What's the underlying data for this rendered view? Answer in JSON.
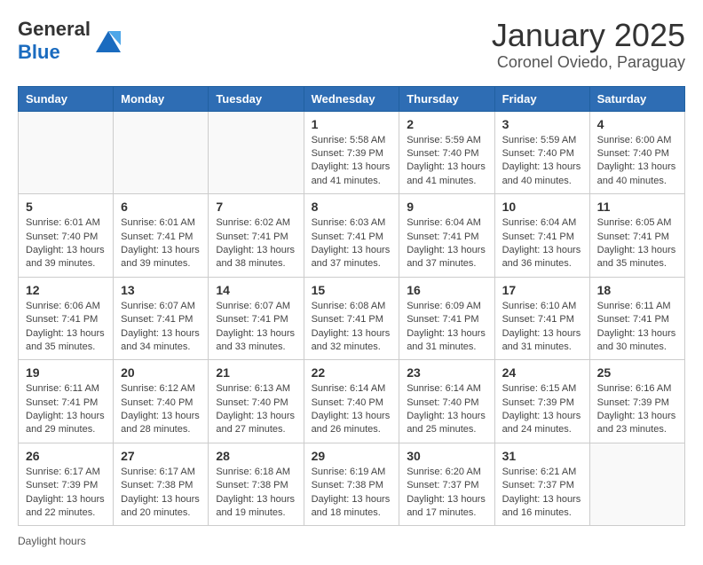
{
  "header": {
    "logo_general": "General",
    "logo_blue": "Blue",
    "month": "January 2025",
    "location": "Coronel Oviedo, Paraguay"
  },
  "days_of_week": [
    "Sunday",
    "Monday",
    "Tuesday",
    "Wednesday",
    "Thursday",
    "Friday",
    "Saturday"
  ],
  "weeks": [
    [
      {
        "day": "",
        "info": ""
      },
      {
        "day": "",
        "info": ""
      },
      {
        "day": "",
        "info": ""
      },
      {
        "day": "1",
        "info": "Sunrise: 5:58 AM\nSunset: 7:39 PM\nDaylight: 13 hours and 41 minutes."
      },
      {
        "day": "2",
        "info": "Sunrise: 5:59 AM\nSunset: 7:40 PM\nDaylight: 13 hours and 41 minutes."
      },
      {
        "day": "3",
        "info": "Sunrise: 5:59 AM\nSunset: 7:40 PM\nDaylight: 13 hours and 40 minutes."
      },
      {
        "day": "4",
        "info": "Sunrise: 6:00 AM\nSunset: 7:40 PM\nDaylight: 13 hours and 40 minutes."
      }
    ],
    [
      {
        "day": "5",
        "info": "Sunrise: 6:01 AM\nSunset: 7:40 PM\nDaylight: 13 hours and 39 minutes."
      },
      {
        "day": "6",
        "info": "Sunrise: 6:01 AM\nSunset: 7:41 PM\nDaylight: 13 hours and 39 minutes."
      },
      {
        "day": "7",
        "info": "Sunrise: 6:02 AM\nSunset: 7:41 PM\nDaylight: 13 hours and 38 minutes."
      },
      {
        "day": "8",
        "info": "Sunrise: 6:03 AM\nSunset: 7:41 PM\nDaylight: 13 hours and 37 minutes."
      },
      {
        "day": "9",
        "info": "Sunrise: 6:04 AM\nSunset: 7:41 PM\nDaylight: 13 hours and 37 minutes."
      },
      {
        "day": "10",
        "info": "Sunrise: 6:04 AM\nSunset: 7:41 PM\nDaylight: 13 hours and 36 minutes."
      },
      {
        "day": "11",
        "info": "Sunrise: 6:05 AM\nSunset: 7:41 PM\nDaylight: 13 hours and 35 minutes."
      }
    ],
    [
      {
        "day": "12",
        "info": "Sunrise: 6:06 AM\nSunset: 7:41 PM\nDaylight: 13 hours and 35 minutes."
      },
      {
        "day": "13",
        "info": "Sunrise: 6:07 AM\nSunset: 7:41 PM\nDaylight: 13 hours and 34 minutes."
      },
      {
        "day": "14",
        "info": "Sunrise: 6:07 AM\nSunset: 7:41 PM\nDaylight: 13 hours and 33 minutes."
      },
      {
        "day": "15",
        "info": "Sunrise: 6:08 AM\nSunset: 7:41 PM\nDaylight: 13 hours and 32 minutes."
      },
      {
        "day": "16",
        "info": "Sunrise: 6:09 AM\nSunset: 7:41 PM\nDaylight: 13 hours and 31 minutes."
      },
      {
        "day": "17",
        "info": "Sunrise: 6:10 AM\nSunset: 7:41 PM\nDaylight: 13 hours and 31 minutes."
      },
      {
        "day": "18",
        "info": "Sunrise: 6:11 AM\nSunset: 7:41 PM\nDaylight: 13 hours and 30 minutes."
      }
    ],
    [
      {
        "day": "19",
        "info": "Sunrise: 6:11 AM\nSunset: 7:41 PM\nDaylight: 13 hours and 29 minutes."
      },
      {
        "day": "20",
        "info": "Sunrise: 6:12 AM\nSunset: 7:40 PM\nDaylight: 13 hours and 28 minutes."
      },
      {
        "day": "21",
        "info": "Sunrise: 6:13 AM\nSunset: 7:40 PM\nDaylight: 13 hours and 27 minutes."
      },
      {
        "day": "22",
        "info": "Sunrise: 6:14 AM\nSunset: 7:40 PM\nDaylight: 13 hours and 26 minutes."
      },
      {
        "day": "23",
        "info": "Sunrise: 6:14 AM\nSunset: 7:40 PM\nDaylight: 13 hours and 25 minutes."
      },
      {
        "day": "24",
        "info": "Sunrise: 6:15 AM\nSunset: 7:39 PM\nDaylight: 13 hours and 24 minutes."
      },
      {
        "day": "25",
        "info": "Sunrise: 6:16 AM\nSunset: 7:39 PM\nDaylight: 13 hours and 23 minutes."
      }
    ],
    [
      {
        "day": "26",
        "info": "Sunrise: 6:17 AM\nSunset: 7:39 PM\nDaylight: 13 hours and 22 minutes."
      },
      {
        "day": "27",
        "info": "Sunrise: 6:17 AM\nSunset: 7:38 PM\nDaylight: 13 hours and 20 minutes."
      },
      {
        "day": "28",
        "info": "Sunrise: 6:18 AM\nSunset: 7:38 PM\nDaylight: 13 hours and 19 minutes."
      },
      {
        "day": "29",
        "info": "Sunrise: 6:19 AM\nSunset: 7:38 PM\nDaylight: 13 hours and 18 minutes."
      },
      {
        "day": "30",
        "info": "Sunrise: 6:20 AM\nSunset: 7:37 PM\nDaylight: 13 hours and 17 minutes."
      },
      {
        "day": "31",
        "info": "Sunrise: 6:21 AM\nSunset: 7:37 PM\nDaylight: 13 hours and 16 minutes."
      },
      {
        "day": "",
        "info": ""
      }
    ]
  ],
  "footer": {
    "daylight_label": "Daylight hours"
  }
}
